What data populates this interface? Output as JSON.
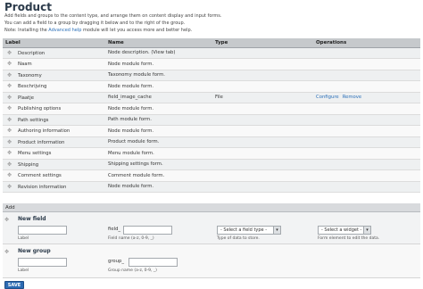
{
  "page": {
    "title": "Product",
    "help_lines": [
      "Add fields and groups to the content type, and arrange them on content display and input forms.",
      "You can add a field to a group by dragging it below and to the right of the group.",
      "Note: Installing the ",
      "Advanced help",
      " module will let you access more and better help."
    ]
  },
  "table": {
    "headers": [
      "Label",
      "Name",
      "Type",
      "Operations"
    ],
    "rows": [
      {
        "label": "Description",
        "name": "Node description. (View tab)",
        "type": "",
        "configure": "",
        "remove": ""
      },
      {
        "label": "Naam",
        "name": "Node module form.",
        "type": "",
        "configure": "",
        "remove": ""
      },
      {
        "label": "Taxonomy",
        "name": "Taxonomy module form.",
        "type": "",
        "configure": "",
        "remove": ""
      },
      {
        "label": "Beschrijving",
        "name": "Node module form.",
        "type": "",
        "configure": "",
        "remove": ""
      },
      {
        "label": "Plaatje",
        "name": "field_image_cache",
        "type": "File",
        "configure": "Configure",
        "remove": "Remove"
      },
      {
        "label": "Publishing options",
        "name": "Node module form.",
        "type": "",
        "configure": "",
        "remove": ""
      },
      {
        "label": "Path settings",
        "name": "Path module form.",
        "type": "",
        "configure": "",
        "remove": ""
      },
      {
        "label": "Authoring information",
        "name": "Node module form.",
        "type": "",
        "configure": "",
        "remove": ""
      },
      {
        "label": "Product information",
        "name": "Product module form.",
        "type": "",
        "configure": "",
        "remove": ""
      },
      {
        "label": "Menu settings",
        "name": "Menu module form.",
        "type": "",
        "configure": "",
        "remove": ""
      },
      {
        "label": "Shipping",
        "name": "Shipping settings form.",
        "type": "",
        "configure": "",
        "remove": ""
      },
      {
        "label": "Comment settings",
        "name": "Comment module form.",
        "type": "",
        "configure": "",
        "remove": ""
      },
      {
        "label": "Revision information",
        "name": "Node module form.",
        "type": "",
        "configure": "",
        "remove": ""
      }
    ]
  },
  "add": {
    "heading": "Add",
    "new_field": {
      "label": "New field",
      "label_desc": "Label",
      "name_prefix": "field_",
      "name_desc": "Field name (a-z, 0-9, _)",
      "type_select": "- Select a field type -",
      "type_desc": "Type of data to store.",
      "widget_select": "- Select a widget -",
      "widget_desc": "Form element to edit the data."
    },
    "new_group": {
      "label": "New group",
      "label_desc": "Label",
      "name_prefix": "group_",
      "name_desc": "Group name (a-z, 0-9, _)"
    }
  },
  "save_label": "SAVE",
  "icons": {
    "drag": "drag-handle-icon",
    "dropdown": "chevron-down-icon"
  },
  "colors": {
    "link": "#2a6fb8",
    "header_bg": "#c6c9cc",
    "button": "#2d6bb3"
  }
}
